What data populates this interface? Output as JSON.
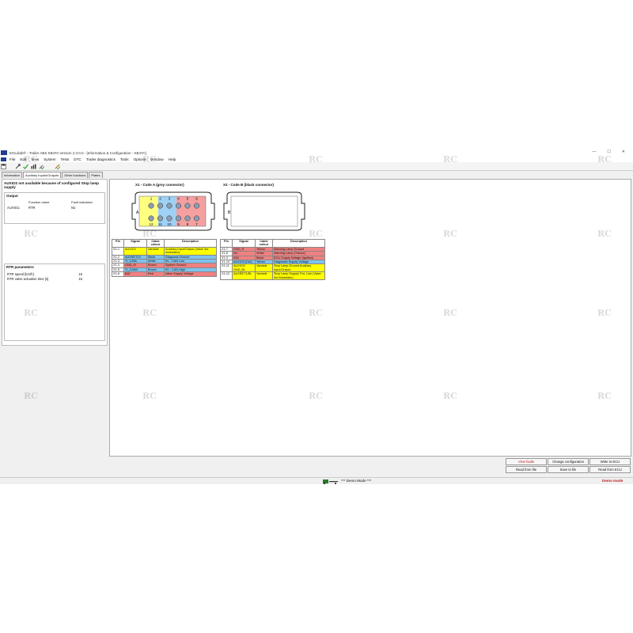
{
  "window": {
    "title": "EOLdiab® - Trailer ABS KB4TA Version 2.3.0.0 - [Information & Configuration - KB4TA]",
    "minimize": "—",
    "maximize": "☐",
    "close": "✕"
  },
  "menu": [
    "File",
    "Edit",
    "View",
    "System",
    "Tests",
    "DTC",
    "Trailer diagnostics",
    "Tools",
    "Options",
    "Window",
    "Help"
  ],
  "toolbar_icons": [
    "save-icon",
    "wrench-icon",
    "check-icon",
    "chart-icon",
    "wrench-check-icon",
    "tool-icon"
  ],
  "tabs": [
    "Information",
    "Auxiliary Inputs/Outputs",
    "Other functions",
    "Plates"
  ],
  "left": {
    "warning": "AUXIO2 not available because of configured Stop lamp supply",
    "output_title": "Output",
    "col_function": "Function name",
    "col_fault": "Fault indication",
    "row_name": "AUXIO1:",
    "row_function": "RTR",
    "row_fault": "No",
    "rtr_title": "RTR parameters",
    "rtr_params": [
      {
        "label": "RTR speed [km/h]",
        "value": "16"
      },
      {
        "label": "RTR valve actuation time [s]",
        "value": "15"
      }
    ]
  },
  "connector_x1": {
    "title": "X1 - Code A (grey connector)",
    "code_letter": "A",
    "top_pins": [
      "1",
      "2",
      "3",
      "4",
      "5",
      "6"
    ],
    "bottom_pins": [
      "12",
      "11",
      "10",
      "9",
      "8",
      "7"
    ]
  },
  "connector_x2": {
    "title": "X2 - Code B (black connector)",
    "code_letter": "B"
  },
  "table_headers": {
    "pin": "Pin",
    "signal": "Signal",
    "colour": "Cable colour",
    "description": "Description"
  },
  "table_x1": [
    {
      "pin": "X1-1",
      "signal": "AUXIO1",
      "colour": "Variable",
      "description": "Auxiliary Input/Output (Valve 3rd modulator)",
      "bg": "#ffff00"
    },
    {
      "pin": "X1-2",
      "signal": "AUXRET23",
      "colour": "Black",
      "description": "Diagnosis Ground",
      "bg": "#7ec3ef"
    },
    {
      "pin": "X1-3",
      "signal": "TI_CANL",
      "colour": "White",
      "description": "5V - CAN Low",
      "bg": "#7ec3ef"
    },
    {
      "pin": "X1-4",
      "signal": "GND_M",
      "colour": "Brown",
      "description": "System Ground",
      "bg": "#f08080"
    },
    {
      "pin": "X1-5",
      "signal": "TI_CANH",
      "colour": "Brown",
      "description": "5V - CAN High",
      "bg": "#7ec3ef"
    },
    {
      "pin": "X1-6",
      "signal": "BAT",
      "colour": "Red",
      "description": "Valve Supply Voltage",
      "bg": "#f08080"
    }
  ],
  "table_x2": [
    {
      "pin": "X1-7",
      "signal": "GND_R",
      "colour": "Yellow",
      "description": "Warning Lamp Ground",
      "bg": "#f08080"
    },
    {
      "pin": "X1-8",
      "signal": "WL",
      "colour": "White",
      "description": "Warning Lamp (Tractor)",
      "bg": "#f08080"
    },
    {
      "pin": "X1-9",
      "signal": "IGN",
      "colour": "Black",
      "description": "ECU Supply Voltage (Ignition)",
      "bg": "#f08080"
    },
    {
      "pin": "X1-10",
      "signal": "AUXIO3 (DIA)",
      "colour": "Yellow",
      "description": "Diagnostic Supply Voltage",
      "bg": "#7ec3ef"
    },
    {
      "pin": "X1-11",
      "signal": "AUXIO2/ GND_BL",
      "colour": "Variable",
      "description": "Stop Lamp Ground Auxiliary Input/Output",
      "bg": "#ffff00"
    },
    {
      "pin": "X1-12",
      "signal": "AUXRET1/BL",
      "colour": "Variable",
      "description": "Stop Lamp Supply/ Pot. Line (Valve 3rd Modulator)",
      "bg": "#ffff00"
    }
  ],
  "buttons": {
    "view_faults": "View faults",
    "change_config": "Change configuration",
    "write_ecu": "Write to ECU",
    "read_file": "Read from file",
    "save_file": "Save to file",
    "read_ecu": "Read from ECU"
  },
  "status": {
    "demo_center": "*** Demo Mode ***",
    "demo_right": "Demo mode"
  },
  "watermark": "RC"
}
